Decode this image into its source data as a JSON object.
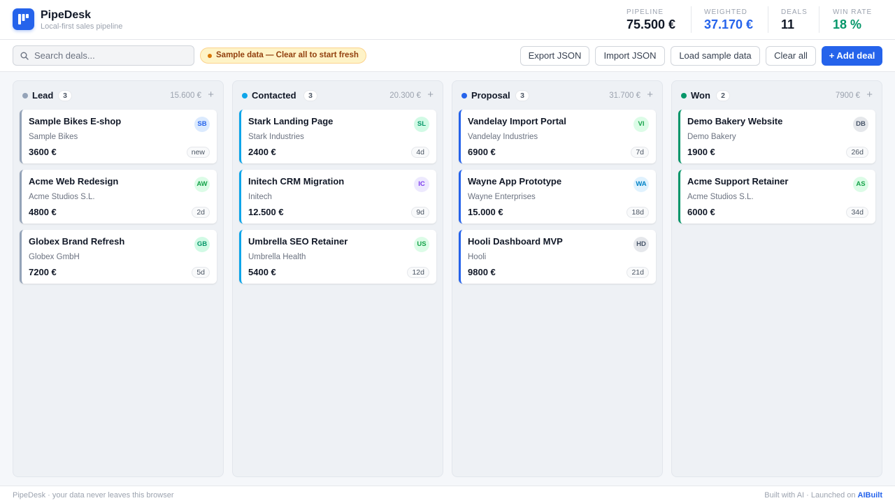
{
  "app": {
    "name": "PipeDesk",
    "subtitle": "Local-first sales pipeline",
    "accent": "#2563eb"
  },
  "stats": [
    {
      "label": "PIPELINE",
      "value": "75.500 €",
      "color": "#111827"
    },
    {
      "label": "WEIGHTED",
      "value": "37.170 €",
      "color": "#2563eb"
    },
    {
      "label": "DEALS",
      "value": "11",
      "color": "#111827"
    },
    {
      "label": "WIN RATE",
      "value": "18 %",
      "color": "#059669"
    }
  ],
  "toolbar": {
    "search_placeholder": "Search deals...",
    "sample_notice": "Sample data — Clear all to start fresh",
    "export_label": "Export JSON",
    "import_label": "Import JSON",
    "load_sample_label": "Load sample data",
    "clear_label": "Clear all",
    "add_label": "+ Add deal"
  },
  "columns": [
    {
      "title": "Lead",
      "count": "3",
      "total": "15.600 €",
      "add": "+",
      "color": "#94a3b8",
      "cards": [
        {
          "title": "Sample Bikes E-shop",
          "company": "Sample Bikes",
          "amount": "3600 €",
          "initials": "SB",
          "age": "new",
          "avatar_bg": "#dbeafe",
          "avatar_fg": "#2563eb"
        },
        {
          "title": "Acme Web Redesign",
          "company": "Acme Studios S.L.",
          "amount": "4800 €",
          "initials": "AW",
          "age": "2d",
          "avatar_bg": "#dcfce7",
          "avatar_fg": "#16a34a"
        },
        {
          "title": "Globex Brand Refresh",
          "company": "Globex GmbH",
          "amount": "7200 €",
          "initials": "GB",
          "age": "5d",
          "avatar_bg": "#d1fae5",
          "avatar_fg": "#059669"
        }
      ]
    },
    {
      "title": "Contacted",
      "count": "3",
      "total": "20.300 €",
      "add": "+",
      "color": "#0ea5e9",
      "cards": [
        {
          "title": "Stark Landing Page",
          "company": "Stark Industries",
          "amount": "2400 €",
          "initials": "SL",
          "age": "4d",
          "avatar_bg": "#d1fae5",
          "avatar_fg": "#059669"
        },
        {
          "title": "Initech CRM Migration",
          "company": "Initech",
          "amount": "12.500 €",
          "initials": "IC",
          "age": "9d",
          "avatar_bg": "#ede9fe",
          "avatar_fg": "#7c3aed"
        },
        {
          "title": "Umbrella SEO Retainer",
          "company": "Umbrella Health",
          "amount": "5400 €",
          "initials": "US",
          "age": "12d",
          "avatar_bg": "#dcfce7",
          "avatar_fg": "#16a34a"
        }
      ]
    },
    {
      "title": "Proposal",
      "count": "3",
      "total": "31.700 €",
      "add": "+",
      "color": "#2563eb",
      "cards": [
        {
          "title": "Vandelay Import Portal",
          "company": "Vandelay Industries",
          "amount": "6900 €",
          "initials": "VI",
          "age": "7d",
          "avatar_bg": "#dcfce7",
          "avatar_fg": "#16a34a"
        },
        {
          "title": "Wayne App Prototype",
          "company": "Wayne Enterprises",
          "amount": "15.000 €",
          "initials": "WA",
          "age": "18d",
          "avatar_bg": "#e0f2fe",
          "avatar_fg": "#0284c7"
        },
        {
          "title": "Hooli Dashboard MVP",
          "company": "Hooli",
          "amount": "9800 €",
          "initials": "HD",
          "age": "21d",
          "avatar_bg": "#e5e7eb",
          "avatar_fg": "#475569"
        }
      ]
    },
    {
      "title": "Won",
      "count": "2",
      "total": "7900 €",
      "add": "+",
      "color": "#059669",
      "cards": [
        {
          "title": "Demo Bakery Website",
          "company": "Demo Bakery",
          "amount": "1900 €",
          "initials": "DB",
          "age": "26d",
          "avatar_bg": "#e5e7eb",
          "avatar_fg": "#475569"
        },
        {
          "title": "Acme Support Retainer",
          "company": "Acme Studios S.L.",
          "amount": "6000 €",
          "initials": "AS",
          "age": "34d",
          "avatar_bg": "#dcfce7",
          "avatar_fg": "#16a34a"
        }
      ]
    }
  ],
  "footer": {
    "left": "PipeDesk · your data never leaves this browser",
    "right_prefix": "Built with AI · Launched on",
    "right_link": "AIBuilt"
  }
}
